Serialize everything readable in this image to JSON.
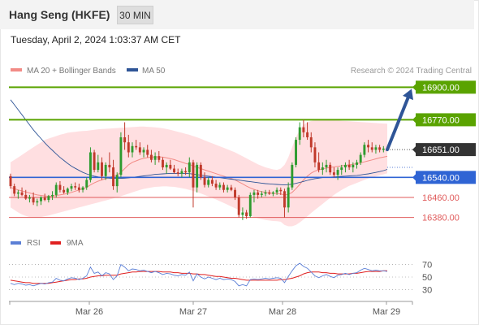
{
  "header": {
    "title": "Hang Seng (HKFE)",
    "timeframe": "30 MIN",
    "timestamp": "Tuesday, April 2, 2024 1:03:37 AM CET"
  },
  "legend": {
    "items": [
      {
        "label": "MA 20 + Bollinger Bands",
        "color": "#f28b86"
      },
      {
        "label": "MA 50",
        "color": "#2f5597"
      }
    ],
    "credit": "Research © 2024 Trading Central"
  },
  "colors": {
    "up": "#2e9b2e",
    "down": "#c0392b",
    "resistance": "#5aa300",
    "support": "#2f64d4",
    "level_red": "#e05a5a",
    "last": "#333333",
    "arrow": "#2f5597",
    "band": "#ffd9dc",
    "rsi": "#5b7fd6",
    "rsi_ma": "#e02020"
  },
  "chart_data": {
    "type": "candlestick",
    "instrument": "Hang Seng (HKFE)",
    "timeframe": "30 MIN",
    "ylim": [
      16340,
      16940
    ],
    "x_ticks": [
      "Mar 26",
      "Mar 27",
      "Mar 28",
      "Mar 29"
    ],
    "levels": [
      {
        "label": "16900.00",
        "value": 16900,
        "kind": "resistance"
      },
      {
        "label": "16770.00",
        "value": 16770,
        "kind": "resistance"
      },
      {
        "label": "16651.00",
        "value": 16651,
        "kind": "last"
      },
      {
        "label": "16540.00",
        "value": 16540,
        "kind": "support"
      },
      {
        "label": "16460.00",
        "value": 16460,
        "kind": "level"
      },
      {
        "label": "16380.00",
        "value": 16380,
        "kind": "level"
      }
    ],
    "forecast_arrow": {
      "from": 16651,
      "to": 16900
    },
    "ohlc": [
      [
        16545,
        16555,
        16495,
        16505
      ],
      [
        16505,
        16515,
        16465,
        16475
      ],
      [
        16475,
        16490,
        16455,
        16480
      ],
      [
        16480,
        16500,
        16465,
        16470
      ],
      [
        16470,
        16490,
        16450,
        16455
      ],
      [
        16455,
        16470,
        16440,
        16460
      ],
      [
        16460,
        16480,
        16430,
        16440
      ],
      [
        16440,
        16455,
        16425,
        16445
      ],
      [
        16445,
        16465,
        16430,
        16460
      ],
      [
        16460,
        16475,
        16445,
        16450
      ],
      [
        16450,
        16470,
        16440,
        16465
      ],
      [
        16465,
        16485,
        16450,
        16470
      ],
      [
        16470,
        16520,
        16460,
        16510
      ],
      [
        16510,
        16525,
        16480,
        16490
      ],
      [
        16490,
        16505,
        16475,
        16480
      ],
      [
        16480,
        16500,
        16470,
        16495
      ],
      [
        16495,
        16515,
        16485,
        16505
      ],
      [
        16505,
        16520,
        16490,
        16500
      ],
      [
        16500,
        16515,
        16480,
        16490
      ],
      [
        16490,
        16505,
        16480,
        16500
      ],
      [
        16500,
        16540,
        16490,
        16530
      ],
      [
        16530,
        16660,
        16520,
        16640
      ],
      [
        16640,
        16650,
        16560,
        16570
      ],
      [
        16570,
        16630,
        16560,
        16600
      ],
      [
        16600,
        16620,
        16530,
        16545
      ],
      [
        16545,
        16600,
        16530,
        16590
      ],
      [
        16590,
        16640,
        16560,
        16580
      ],
      [
        16580,
        16610,
        16490,
        16505
      ],
      [
        16505,
        16560,
        16480,
        16550
      ],
      [
        16550,
        16720,
        16540,
        16700
      ],
      [
        16700,
        16760,
        16650,
        16680
      ],
      [
        16680,
        16710,
        16620,
        16640
      ],
      [
        16640,
        16680,
        16620,
        16665
      ],
      [
        16665,
        16690,
        16650,
        16660
      ],
      [
        16660,
        16680,
        16630,
        16640
      ],
      [
        16640,
        16660,
        16620,
        16650
      ],
      [
        16650,
        16670,
        16620,
        16630
      ],
      [
        16630,
        16650,
        16600,
        16610
      ],
      [
        16610,
        16640,
        16590,
        16625
      ],
      [
        16625,
        16645,
        16600,
        16610
      ],
      [
        16610,
        16620,
        16570,
        16580
      ],
      [
        16580,
        16600,
        16555,
        16590
      ],
      [
        16590,
        16610,
        16570,
        16575
      ],
      [
        16575,
        16590,
        16555,
        16560
      ],
      [
        16560,
        16575,
        16545,
        16555
      ],
      [
        16555,
        16575,
        16540,
        16565
      ],
      [
        16565,
        16580,
        16550,
        16560
      ],
      [
        16560,
        16620,
        16540,
        16600
      ],
      [
        16600,
        16610,
        16420,
        16500
      ],
      [
        16500,
        16600,
        16480,
        16590
      ],
      [
        16590,
        16600,
        16530,
        16540
      ],
      [
        16540,
        16560,
        16500,
        16510
      ],
      [
        16510,
        16540,
        16500,
        16530
      ],
      [
        16530,
        16545,
        16505,
        16515
      ],
      [
        16515,
        16530,
        16490,
        16500
      ],
      [
        16500,
        16520,
        16490,
        16510
      ],
      [
        16510,
        16520,
        16480,
        16490
      ],
      [
        16490,
        16510,
        16480,
        16500
      ],
      [
        16500,
        16510,
        16485,
        16490
      ],
      [
        16490,
        16500,
        16450,
        16460
      ],
      [
        16460,
        16470,
        16380,
        16390
      ],
      [
        16390,
        16420,
        16370,
        16400
      ],
      [
        16400,
        16410,
        16375,
        16385
      ],
      [
        16385,
        16480,
        16380,
        16470
      ],
      [
        16470,
        16490,
        16440,
        16480
      ],
      [
        16480,
        16490,
        16455,
        16470
      ],
      [
        16470,
        16485,
        16460,
        16475
      ],
      [
        16475,
        16490,
        16465,
        16480
      ],
      [
        16480,
        16490,
        16470,
        16475
      ],
      [
        16475,
        16485,
        16465,
        16480
      ],
      [
        16480,
        16500,
        16470,
        16490
      ],
      [
        16490,
        16500,
        16470,
        16485
      ],
      [
        16485,
        16495,
        16380,
        16420
      ],
      [
        16420,
        16520,
        16400,
        16500
      ],
      [
        16500,
        16600,
        16490,
        16590
      ],
      [
        16590,
        16700,
        16580,
        16690
      ],
      [
        16690,
        16760,
        16670,
        16740
      ],
      [
        16740,
        16770,
        16700,
        16720
      ],
      [
        16720,
        16760,
        16690,
        16700
      ],
      [
        16700,
        16720,
        16640,
        16660
      ],
      [
        16660,
        16680,
        16580,
        16600
      ],
      [
        16600,
        16640,
        16560,
        16570
      ],
      [
        16570,
        16600,
        16550,
        16580
      ],
      [
        16580,
        16610,
        16560,
        16590
      ],
      [
        16590,
        16600,
        16550,
        16560
      ],
      [
        16560,
        16580,
        16540,
        16550
      ],
      [
        16550,
        16580,
        16530,
        16570
      ],
      [
        16570,
        16590,
        16550,
        16580
      ],
      [
        16580,
        16600,
        16560,
        16590
      ],
      [
        16590,
        16610,
        16570,
        16580
      ],
      [
        16580,
        16600,
        16560,
        16590
      ],
      [
        16590,
        16610,
        16575,
        16600
      ],
      [
        16600,
        16640,
        16590,
        16630
      ],
      [
        16630,
        16680,
        16620,
        16670
      ],
      [
        16670,
        16690,
        16640,
        16660
      ],
      [
        16660,
        16680,
        16640,
        16650
      ],
      [
        16650,
        16670,
        16635,
        16660
      ],
      [
        16660,
        16670,
        16640,
        16650
      ],
      [
        16650,
        16665,
        16640,
        16655
      ],
      [
        16655,
        16665,
        16645,
        16651
      ]
    ],
    "rsi_axis": [
      70,
      50,
      30
    ],
    "rsi_ylim": [
      15,
      85
    ],
    "rsi": [
      40,
      38,
      40,
      39,
      37,
      38,
      36,
      38,
      40,
      39,
      41,
      42,
      48,
      45,
      44,
      47,
      49,
      48,
      46,
      48,
      52,
      66,
      56,
      58,
      52,
      57,
      55,
      46,
      52,
      70,
      66,
      60,
      63,
      62,
      60,
      61,
      59,
      57,
      59,
      57,
      54,
      56,
      55,
      53,
      52,
      54,
      53,
      58,
      44,
      55,
      50,
      47,
      50,
      48,
      46,
      48,
      46,
      47,
      46,
      43,
      36,
      38,
      36,
      46,
      47,
      46,
      47,
      48,
      47,
      48,
      49,
      48,
      41,
      51,
      60,
      68,
      72,
      67,
      64,
      58,
      52,
      49,
      52,
      54,
      51,
      49,
      53,
      54,
      56,
      54,
      56,
      57,
      61,
      64,
      62,
      60,
      61,
      60,
      60,
      59
    ],
    "rsi_ma": [
      45,
      44,
      43,
      42,
      41,
      41,
      40,
      40,
      40,
      40,
      40,
      41,
      42,
      43,
      44,
      45,
      46,
      46,
      47,
      47,
      48,
      50,
      51,
      52,
      52,
      53,
      53,
      53,
      53,
      55,
      56,
      57,
      58,
      58,
      59,
      59,
      59,
      59,
      59,
      59,
      58,
      58,
      58,
      57,
      57,
      56,
      56,
      56,
      55,
      55,
      54,
      54,
      53,
      52,
      51,
      51,
      50,
      49,
      48,
      48,
      47,
      46,
      45,
      45,
      45,
      45,
      45,
      45,
      45,
      45,
      45,
      46,
      46,
      47,
      48,
      50,
      52,
      55,
      57,
      58,
      58,
      58,
      57,
      57,
      56,
      56,
      55,
      55,
      55,
      55,
      56,
      56,
      57,
      58,
      59,
      59,
      59,
      59,
      60,
      60
    ],
    "ma20": [
      16500,
      16495,
      16490,
      16486,
      16482,
      16478,
      16474,
      16470,
      16468,
      16466,
      16465,
      16465,
      16468,
      16470,
      16473,
      16476,
      16480,
      16485,
      16490,
      16495,
      16500,
      16510,
      16518,
      16525,
      16530,
      16535,
      16540,
      16545,
      16550,
      16560,
      16575,
      16590,
      16600,
      16606,
      16612,
      16616,
      16619,
      16621,
      16622,
      16622,
      16621,
      16618,
      16615,
      16611,
      16606,
      16601,
      16596,
      16592,
      16585,
      16580,
      16575,
      16570,
      16565,
      16560,
      16555,
      16550,
      16545,
      16540,
      16536,
      16530,
      16522,
      16514,
      16505,
      16498,
      16492,
      16487,
      16483,
      16480,
      16478,
      16476,
      16475,
      16474,
      16470,
      16472,
      16480,
      16495,
      16512,
      16530,
      16545,
      16557,
      16565,
      16570,
      16574,
      16577,
      16580,
      16582,
      16584,
      16586,
      16588,
      16590,
      16592,
      16595,
      16598,
      16602,
      16606,
      16610,
      16614,
      16618,
      16621,
      16624
    ],
    "bb_upper": [
      16600,
      16610,
      16620,
      16630,
      16640,
      16650,
      16660,
      16670,
      16680,
      16690,
      16695,
      16700,
      16705,
      16710,
      16714,
      16718,
      16720,
      16722,
      16724,
      16725,
      16726,
      16728,
      16730,
      16732,
      16733,
      16734,
      16735,
      16736,
      16737,
      16738,
      16739,
      16740,
      16741,
      16742,
      16743,
      16743,
      16742,
      16741,
      16740,
      16738,
      16736,
      16733,
      16730,
      16726,
      16722,
      16718,
      16714,
      16710,
      16705,
      16700,
      16694,
      16688,
      16682,
      16676,
      16670,
      16664,
      16658,
      16652,
      16646,
      16640,
      16632,
      16624,
      16616,
      16608,
      16600,
      16592,
      16586,
      16580,
      16576,
      16572,
      16570,
      16575,
      16590,
      16620,
      16660,
      16700,
      16730,
      16750,
      16760,
      16765,
      16768,
      16769,
      16770,
      16770,
      16769,
      16768,
      16767,
      16766,
      16765,
      16764,
      16763,
      16762,
      16761,
      16760,
      16759,
      16758,
      16757,
      16756,
      16755,
      16754
    ],
    "bb_lower": [
      16420,
      16410,
      16400,
      16392,
      16386,
      16382,
      16380,
      16380,
      16382,
      16385,
      16388,
      16392,
      16396,
      16400,
      16404,
      16408,
      16412,
      16416,
      16420,
      16424,
      16428,
      16432,
      16436,
      16440,
      16444,
      16448,
      16452,
      16456,
      16460,
      16465,
      16470,
      16475,
      16480,
      16485,
      16490,
      16494,
      16497,
      16500,
      16502,
      16503,
      16504,
      16504,
      16503,
      16502,
      16500,
      16497,
      16494,
      16490,
      16486,
      16481,
      16476,
      16470,
      16464,
      16458,
      16452,
      16445,
      16438,
      16431,
      16424,
      16417,
      16410,
      16402,
      16395,
      16388,
      16382,
      16377,
      16373,
      16370,
      16368,
      16366,
      16365,
      16363,
      16350,
      16345,
      16345,
      16350,
      16360,
      16372,
      16385,
      16398,
      16410,
      16422,
      16434,
      16446,
      16458,
      16470,
      16480,
      16490,
      16498,
      16506,
      16512,
      16518,
      16524,
      16530,
      16536,
      16540,
      16544,
      16548,
      16552,
      16556
    ],
    "ma50": [
      16850,
      16830,
      16810,
      16790,
      16770,
      16750,
      16730,
      16712,
      16695,
      16678,
      16662,
      16648,
      16634,
      16620,
      16608,
      16596,
      16585,
      16576,
      16568,
      16560,
      16554,
      16549,
      16545,
      16542,
      16540,
      16538,
      16537,
      16536,
      16536,
      16536,
      16537,
      16538,
      16540,
      16542,
      16544,
      16546,
      16548,
      16550,
      16552,
      16553,
      16554,
      16555,
      16556,
      16556,
      16556,
      16556,
      16556,
      16555,
      16553,
      16551,
      16549,
      16547,
      16545,
      16543,
      16541,
      16539,
      16537,
      16535,
      16533,
      16531,
      16529,
      16527,
      16525,
      16523,
      16521,
      16519,
      16517,
      16515,
      16514,
      16513,
      16512,
      16511,
      16510,
      16511,
      16513,
      16516,
      16520,
      16524,
      16528,
      16532,
      16535,
      16537,
      16539,
      16540,
      16541,
      16542,
      16543,
      16544,
      16545,
      16546,
      16547,
      16548,
      16550,
      16552,
      16554,
      16557,
      16560,
      16563,
      16567,
      16572
    ]
  }
}
